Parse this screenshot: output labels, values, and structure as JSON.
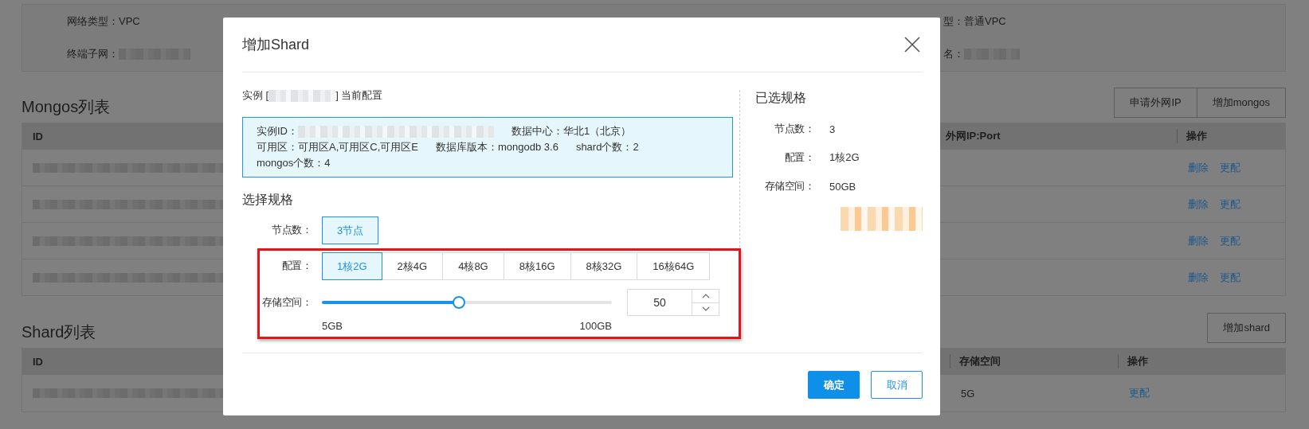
{
  "background_page": {
    "info_panel": {
      "rows": [
        {
          "left": {
            "text": "网络类型：VPC"
          },
          "right": {
            "text": "型：普通VPC"
          }
        },
        {
          "left": {
            "text": "终端子网：",
            "redacted": true
          },
          "right": {
            "text": "名：",
            "redacted": true
          }
        }
      ]
    },
    "mongos_list": {
      "title": "Mongos列表",
      "buttons": [
        "申请外网IP",
        "增加mongos"
      ],
      "columns": [
        "ID",
        "外网IP:Port",
        "操作"
      ],
      "rows": [
        {
          "actions": [
            "删除",
            "更配"
          ]
        },
        {
          "actions": [
            "删除",
            "更配"
          ]
        },
        {
          "actions": [
            "删除",
            "更配"
          ]
        },
        {
          "actions": [
            "删除",
            "更配"
          ]
        }
      ]
    },
    "shard_list": {
      "title": "Shard列表",
      "buttons": [
        "增加shard"
      ],
      "columns": [
        "ID",
        "存储空间",
        "操作"
      ],
      "rows": [
        {
          "storage": "5G",
          "actions": [
            "更配"
          ]
        }
      ]
    }
  },
  "dialog": {
    "title": "增加Shard",
    "instance_prefix": "实例 [",
    "instance_suffix": "] 当前配置",
    "info_lines": [
      [
        {
          "text": "实例ID：",
          "redacted": true
        },
        {
          "text": "数据中心：华北1（北京）"
        }
      ],
      [
        {
          "text": "可用区：可用区A,可用区C,可用区E"
        },
        {
          "text": "数据库版本：mongodb 3.6"
        },
        {
          "text": "shard个数：2"
        }
      ],
      [
        {
          "text": "mongos个数：4"
        }
      ]
    ],
    "spec": {
      "title": "选择规格",
      "node_count": {
        "label": "节点数：",
        "options": [
          {
            "label": "3节点",
            "selected": true
          }
        ]
      },
      "config": {
        "label": "配置：",
        "options": [
          {
            "label": "1核2G",
            "selected": true
          },
          {
            "label": "2核4G",
            "selected": false
          },
          {
            "label": "4核8G",
            "selected": false
          },
          {
            "label": "8核16G",
            "selected": false
          },
          {
            "label": "8核32G",
            "selected": false
          },
          {
            "label": "16核64G",
            "selected": false
          }
        ]
      },
      "storage": {
        "label": "存储空间：",
        "level": 0.47,
        "value": "50",
        "min_label": "5GB",
        "max_label": "100GB"
      }
    },
    "summary": {
      "title": "已选规格",
      "rows": [
        {
          "label": "节点数：",
          "value": "3"
        },
        {
          "label": "配置：",
          "value": "1核2G"
        },
        {
          "label": "存储空间：",
          "value": "50GB"
        }
      ]
    },
    "buttons": [
      {
        "label": "确定",
        "kind": "primary"
      },
      {
        "label": "取消",
        "kind": "secondary"
      }
    ]
  }
}
